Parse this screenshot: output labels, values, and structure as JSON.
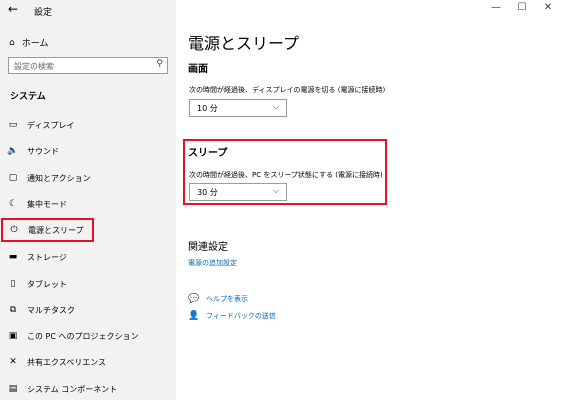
{
  "window": {
    "title": "設定",
    "back_icon": "←",
    "minimize": "—",
    "maximize": "☐",
    "close": "✕"
  },
  "sidebar": {
    "home_label": "ホーム",
    "search_placeholder": "設定の検索",
    "section": "システム",
    "items": [
      {
        "label": "ディスプレイ",
        "icon": "▭"
      },
      {
        "label": "サウンド",
        "icon": "🔈"
      },
      {
        "label": "通知とアクション",
        "icon": "▢"
      },
      {
        "label": "集中モード",
        "icon": "☾"
      },
      {
        "label": "電源とスリープ",
        "icon": "⏻"
      },
      {
        "label": "ストレージ",
        "icon": "▬"
      },
      {
        "label": "タブレット",
        "icon": "▯"
      },
      {
        "label": "マルチタスク",
        "icon": "⧉"
      },
      {
        "label": "この PC へのプロジェクション",
        "icon": "▣"
      },
      {
        "label": "共有エクスペリエンス",
        "icon": "✕"
      },
      {
        "label": "システム コンポーネント",
        "icon": "▤"
      }
    ]
  },
  "main": {
    "title": "電源とスリープ",
    "screen": {
      "heading": "画面",
      "description": "次の時間が経過後、ディスプレイの電源を切る (電源に接続時)",
      "value": "10 分"
    },
    "sleep": {
      "heading": "スリープ",
      "description": "次の時間が経過後、PC をスリープ状態にする (電源に接続時)",
      "value": "30 分"
    },
    "related": {
      "heading": "関連設定",
      "link": "電源の追加設定"
    },
    "help": {
      "show_help": "ヘルプを表示",
      "feedback": "フィードバックの送信"
    }
  },
  "accent": {
    "highlight": "#e81123",
    "link": "#0067b8"
  }
}
